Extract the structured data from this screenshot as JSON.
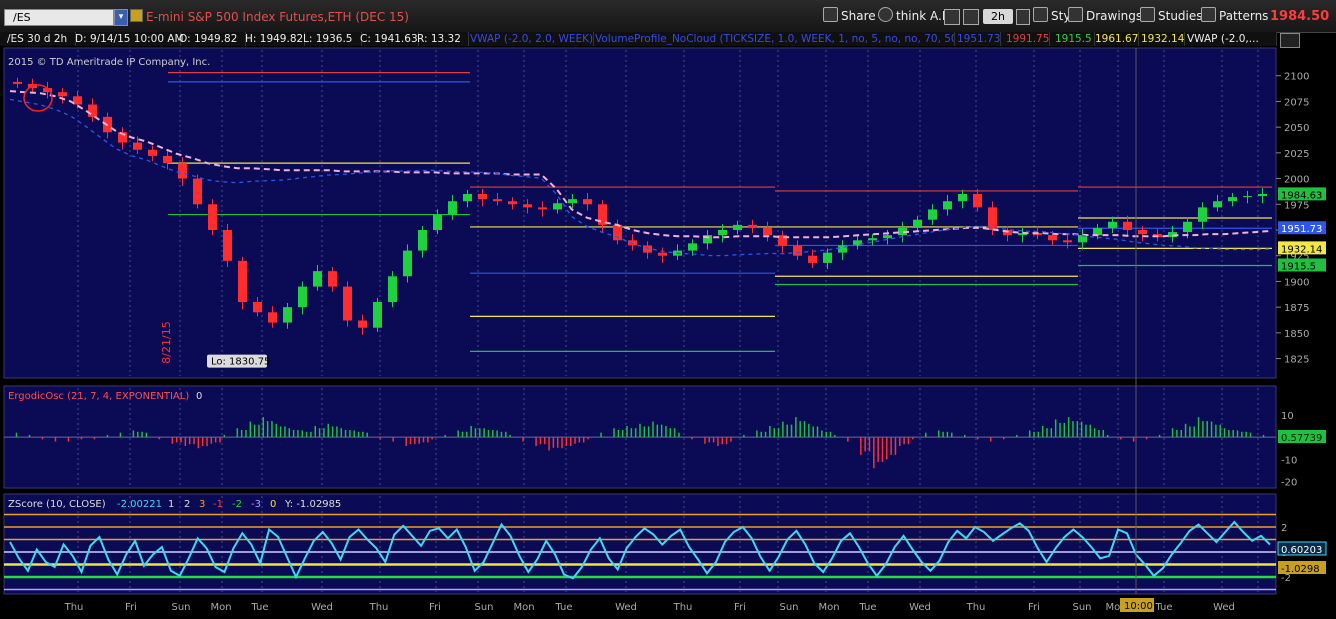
{
  "toolbar": {
    "symbol": "/ES",
    "description": "E-mini S&P 500 Index Futures,ETH (DEC 15)",
    "share_label": "Share",
    "think_label": "think A.I.",
    "aggregation": "2h",
    "style_label": "Style",
    "drawings_label": "Drawings",
    "studies_label": "Studies",
    "patterns_label": "Patterns",
    "last_price": "1984.50",
    "last_price_color": "#ff3b3b"
  },
  "header": {
    "symbol_period": "/ES 30 d 2h",
    "date": "D: 9/14/15 10:00 AM",
    "open": "O: 1949.82",
    "high": "H: 1949.82",
    "low": "L: 1936.5",
    "close": "C: 1941.63",
    "range": "R: 13.32",
    "vwap_label": "VWAP (-2.0, 2.0, WEEK)",
    "vp_label": "VolumeProfile_NoCloud (TICKSIZE, 1.0, WEEK, 1, no, 5, no, no, 70, 50, 60)",
    "v1": "1951.73",
    "v2": "1991.75",
    "v3": "1915.5",
    "v4": "1961.67",
    "v5": "1932.14",
    "vwap2_label": "VWAP (-2.0,..."
  },
  "copyright": "2015 © TD Ameritrade IP Company, Inc.",
  "chart_data": [
    {
      "type": "candlestick",
      "title": "/ES 30 d 2h",
      "ylim": [
        1810,
        2125
      ],
      "yticks": [
        1825,
        1850,
        1875,
        1900,
        1925,
        1950,
        1975,
        2000,
        2025,
        2050,
        2075,
        2100
      ],
      "x_day_labels": [
        "Thu",
        "Fri",
        "Sun",
        "Mon",
        "Tue",
        "Wed",
        "Thu",
        "Fri",
        "Sun",
        "Mon",
        "Tue",
        "Wed",
        "Thu",
        "Fri",
        "Sun",
        "Mon",
        "Tue",
        "Wed",
        "Thu",
        "Fri",
        "Sun",
        "Mon",
        "Tue",
        "Wed"
      ],
      "series": [
        {
          "name": "Close",
          "values": [
            2092,
            2088,
            2084,
            2080,
            2072,
            2060,
            2045,
            2035,
            2028,
            2022,
            2015,
            2000,
            1975,
            1950,
            1920,
            1880,
            1870,
            1860,
            1875,
            1895,
            1910,
            1895,
            1862,
            1855,
            1880,
            1905,
            1930,
            1950,
            1965,
            1978,
            1985,
            1980,
            1978,
            1975,
            1972,
            1970,
            1976,
            1980,
            1975,
            1955,
            1940,
            1935,
            1928,
            1925,
            1930,
            1937,
            1945,
            1950,
            1955,
            1952,
            1945,
            1935,
            1925,
            1918,
            1928,
            1935,
            1940,
            1942,
            1945,
            1952,
            1960,
            1970,
            1978,
            1985,
            1972,
            1950,
            1945,
            1947,
            1945,
            1940,
            1938,
            1945,
            1952,
            1958,
            1950,
            1946,
            1943,
            1948,
            1958,
            1972,
            1978,
            1982,
            1983,
            1985
          ]
        }
      ],
      "low_annotation": "Lo: 1830.75",
      "date_annotation": "8/21/15",
      "price_labels": [
        {
          "text": "1984.63",
          "value": 1984.63,
          "color": "#1fbf3f"
        },
        {
          "text": "1951.73",
          "value": 1951.73,
          "color": "#2f56e8"
        },
        {
          "text": "1932.14",
          "value": 1932.14,
          "color": "#f1e64a"
        },
        {
          "text": "1915.5",
          "value": 1915.5,
          "color": "#1fbf3f"
        }
      ],
      "vwap_line": [
        2085,
        2084,
        2083,
        2080,
        2075,
        2066,
        2056,
        2046,
        2040,
        2036,
        2030,
        2024,
        2020,
        2015,
        2012,
        2010,
        2010,
        2009,
        2008,
        2008,
        2008,
        2008,
        2007,
        2007,
        2007,
        2007,
        2006,
        2006,
        2006,
        2005,
        2005,
        2005,
        2005,
        2004,
        2004,
        2004,
        1990,
        1970,
        1962,
        1958,
        1955,
        1950,
        1947,
        1945,
        1944,
        1944,
        1943,
        1943,
        1944,
        1944,
        1944,
        1943,
        1943,
        1943,
        1943,
        1944,
        1945,
        1946,
        1947,
        1948,
        1949,
        1950,
        1951,
        1952,
        1952,
        1950,
        1948,
        1947,
        1947,
        1946,
        1946,
        1945,
        1945,
        1945,
        1944,
        1944,
        1944,
        1945,
        1945,
        1946,
        1946,
        1947,
        1948,
        1949
      ]
    },
    {
      "type": "bar",
      "title": "ErgodicOsc (21, 7, 4, EXPONENTIAL)",
      "value_label": "0",
      "current": "0.57739",
      "yticks": [
        10,
        0,
        -10,
        -20
      ],
      "ylim": [
        -22,
        14
      ],
      "values": [
        2,
        1,
        -1,
        -2,
        -2,
        -1,
        -1,
        1,
        2,
        3,
        2,
        -1,
        -3,
        -4,
        -5,
        -3,
        1,
        4,
        7,
        9,
        6,
        4,
        3,
        5,
        6,
        4,
        3,
        2,
        -1,
        -2,
        -4,
        -3,
        -1,
        1,
        3,
        5,
        4,
        3,
        1,
        -2,
        -4,
        -6,
        -5,
        -3,
        -1,
        2,
        4,
        5,
        6,
        7,
        5,
        2,
        -1,
        -3,
        -4,
        -2,
        1,
        3,
        5,
        7,
        9,
        6,
        3,
        1,
        -2,
        -8,
        -14,
        -10,
        -4,
        -1,
        2,
        3,
        2,
        1,
        -1,
        -2,
        -1,
        1,
        3,
        5,
        8,
        9,
        7,
        4,
        1,
        -1,
        -2,
        -1,
        1,
        4,
        6,
        9,
        7,
        4,
        3,
        2,
        1
      ]
    },
    {
      "type": "line",
      "title": "ZScore (10, CLOSE)",
      "current_text": "-2.00221",
      "level_labels": [
        "1",
        "2",
        "3",
        "-1",
        "-2",
        "-3",
        "0"
      ],
      "y_readout": "Y: -1.02985",
      "ylim": [
        -3.2,
        3.2
      ],
      "yticks": [
        2,
        0,
        -2
      ],
      "levels": [
        {
          "value": 3,
          "color": "#f0a020"
        },
        {
          "value": 2,
          "color": "#f0a020"
        },
        {
          "value": 1,
          "color": "#f0a020"
        },
        {
          "value": -1,
          "color": "#f0e640"
        },
        {
          "value": -2,
          "color": "#22dd44"
        },
        {
          "value": -3,
          "color": "#b0a0ff"
        },
        {
          "value": 0,
          "color": "#d0d0ff"
        }
      ],
      "current": "0.60203",
      "crosshair_value": "-1.0298",
      "values": [
        0.8,
        -0.5,
        -1.5,
        0.2,
        -0.8,
        -1.2,
        0.6,
        -0.3,
        -1.6,
        0.5,
        1.2,
        -0.6,
        -1.8,
        -0.2,
        0.9,
        -1.1,
        -0.2,
        0.4,
        -1.5,
        -1.9,
        -0.5,
        1.1,
        0.3,
        -1.2,
        -1.6,
        0.3,
        1.5,
        0.6,
        -0.9,
        1.8,
        1.2,
        -0.4,
        -2.0,
        -0.5,
        0.9,
        1.6,
        0.7,
        -0.6,
        1.2,
        1.8,
        1.0,
        0.3,
        -0.8,
        1.4,
        2.1,
        1.3,
        0.5,
        1.7,
        1.9,
        1.1,
        1.8,
        0.4,
        -1.5,
        -0.8,
        0.7,
        2.2,
        1.3,
        -0.3,
        -1.6,
        -0.6,
        0.9,
        -0.2,
        -1.8,
        -2.1,
        -1.2,
        0.2,
        1.1,
        -0.5,
        -1.4,
        0.3,
        1.2,
        1.9,
        1.4,
        0.6,
        1.3,
        1.8,
        0.4,
        -0.6,
        -1.7,
        -0.8,
        0.8,
        1.6,
        2.0,
        1.1,
        -0.4,
        -1.5,
        -0.4,
        1.0,
        1.7,
        0.6,
        -0.9,
        -1.6,
        -0.5,
        0.9,
        1.5,
        0.4,
        -0.9,
        -1.9,
        -1.0,
        0.4,
        1.3,
        0.2,
        -0.8,
        -1.5,
        -0.7,
        0.8,
        1.7,
        1.1,
        2.0,
        1.6,
        0.9,
        1.4,
        1.9,
        2.3,
        1.7,
        0.3,
        -0.8,
        0.3,
        1.2,
        1.8,
        1.2,
        0.4,
        -0.5,
        -0.3,
        1.8,
        1.5,
        -0.2,
        -1.0,
        -1.9,
        -1.3,
        -0.2,
        0.7,
        1.7,
        2.2,
        1.5,
        0.8,
        1.6,
        2.4,
        1.6,
        0.9,
        1.3,
        0.6
      ]
    }
  ],
  "x_cursor_label": "10:00"
}
